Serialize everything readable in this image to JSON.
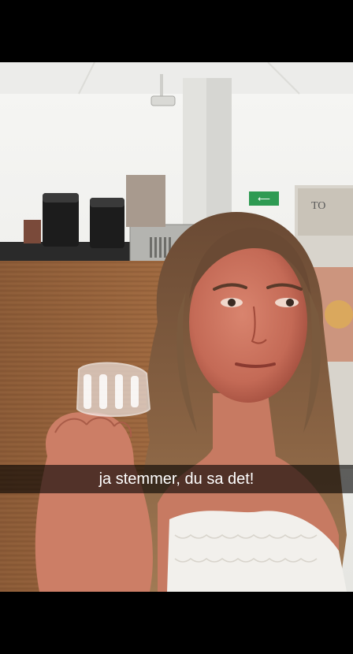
{
  "snap": {
    "caption": "ja stemmer, du sa det!",
    "sign_text": "TO",
    "exit_sign": "⟵"
  }
}
